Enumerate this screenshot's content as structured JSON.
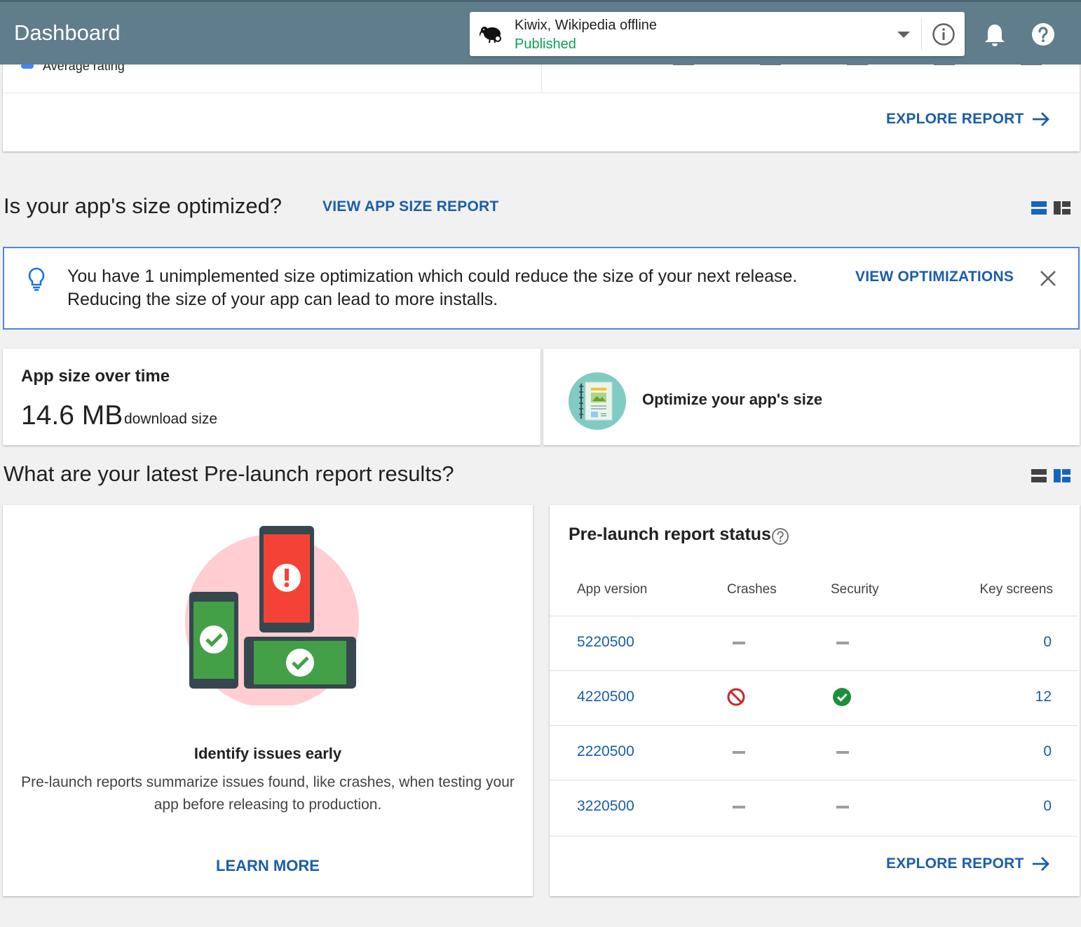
{
  "header": {
    "title": "Dashboard",
    "app_name": "Kiwix, Wikipedia offline",
    "app_status": "Published"
  },
  "ratings_card": {
    "legend_label": "Average rating",
    "explore_label": "EXPLORE REPORT"
  },
  "size_section": {
    "title": "Is your app's size optimized?",
    "link_label": "VIEW APP SIZE REPORT",
    "banner": {
      "line1": "You have 1 unimplemented size optimization which could reduce the size of your next release.",
      "line2": "Reducing the size of your app can lead to more installs.",
      "action_label": "VIEW OPTIMIZATIONS"
    },
    "size_card": {
      "label": "App size over time",
      "value": "14.6 MB",
      "unit": "download size"
    },
    "optimize_card": {
      "label": "Optimize your app's size"
    }
  },
  "prelaunch_section": {
    "title": "What are your latest Pre-launch report results?",
    "promo": {
      "heading": "Identify issues early",
      "description": "Pre-launch reports summarize issues found, like crashes, when testing your app before releasing to production.",
      "learn_more_label": "LEARN MORE"
    },
    "status": {
      "title": "Pre-launch report status",
      "columns": [
        "App version",
        "Crashes",
        "Security",
        "Key screens"
      ],
      "rows": [
        {
          "version": "5220500",
          "crashes": "none",
          "security": "none",
          "key_screens": "0"
        },
        {
          "version": "4220500",
          "crashes": "blocked",
          "security": "passed",
          "key_screens": "12"
        },
        {
          "version": "2220500",
          "crashes": "none",
          "security": "none",
          "key_screens": "0"
        },
        {
          "version": "3220500",
          "crashes": "none",
          "security": "none",
          "key_screens": "0"
        }
      ],
      "explore_label": "EXPLORE REPORT"
    }
  },
  "colors": {
    "header_bg": "#607d8b",
    "link_blue": "#1a5ea8",
    "published_green": "#0f9d58",
    "error_red": "#c62828",
    "success_green": "#1e8e3e"
  }
}
